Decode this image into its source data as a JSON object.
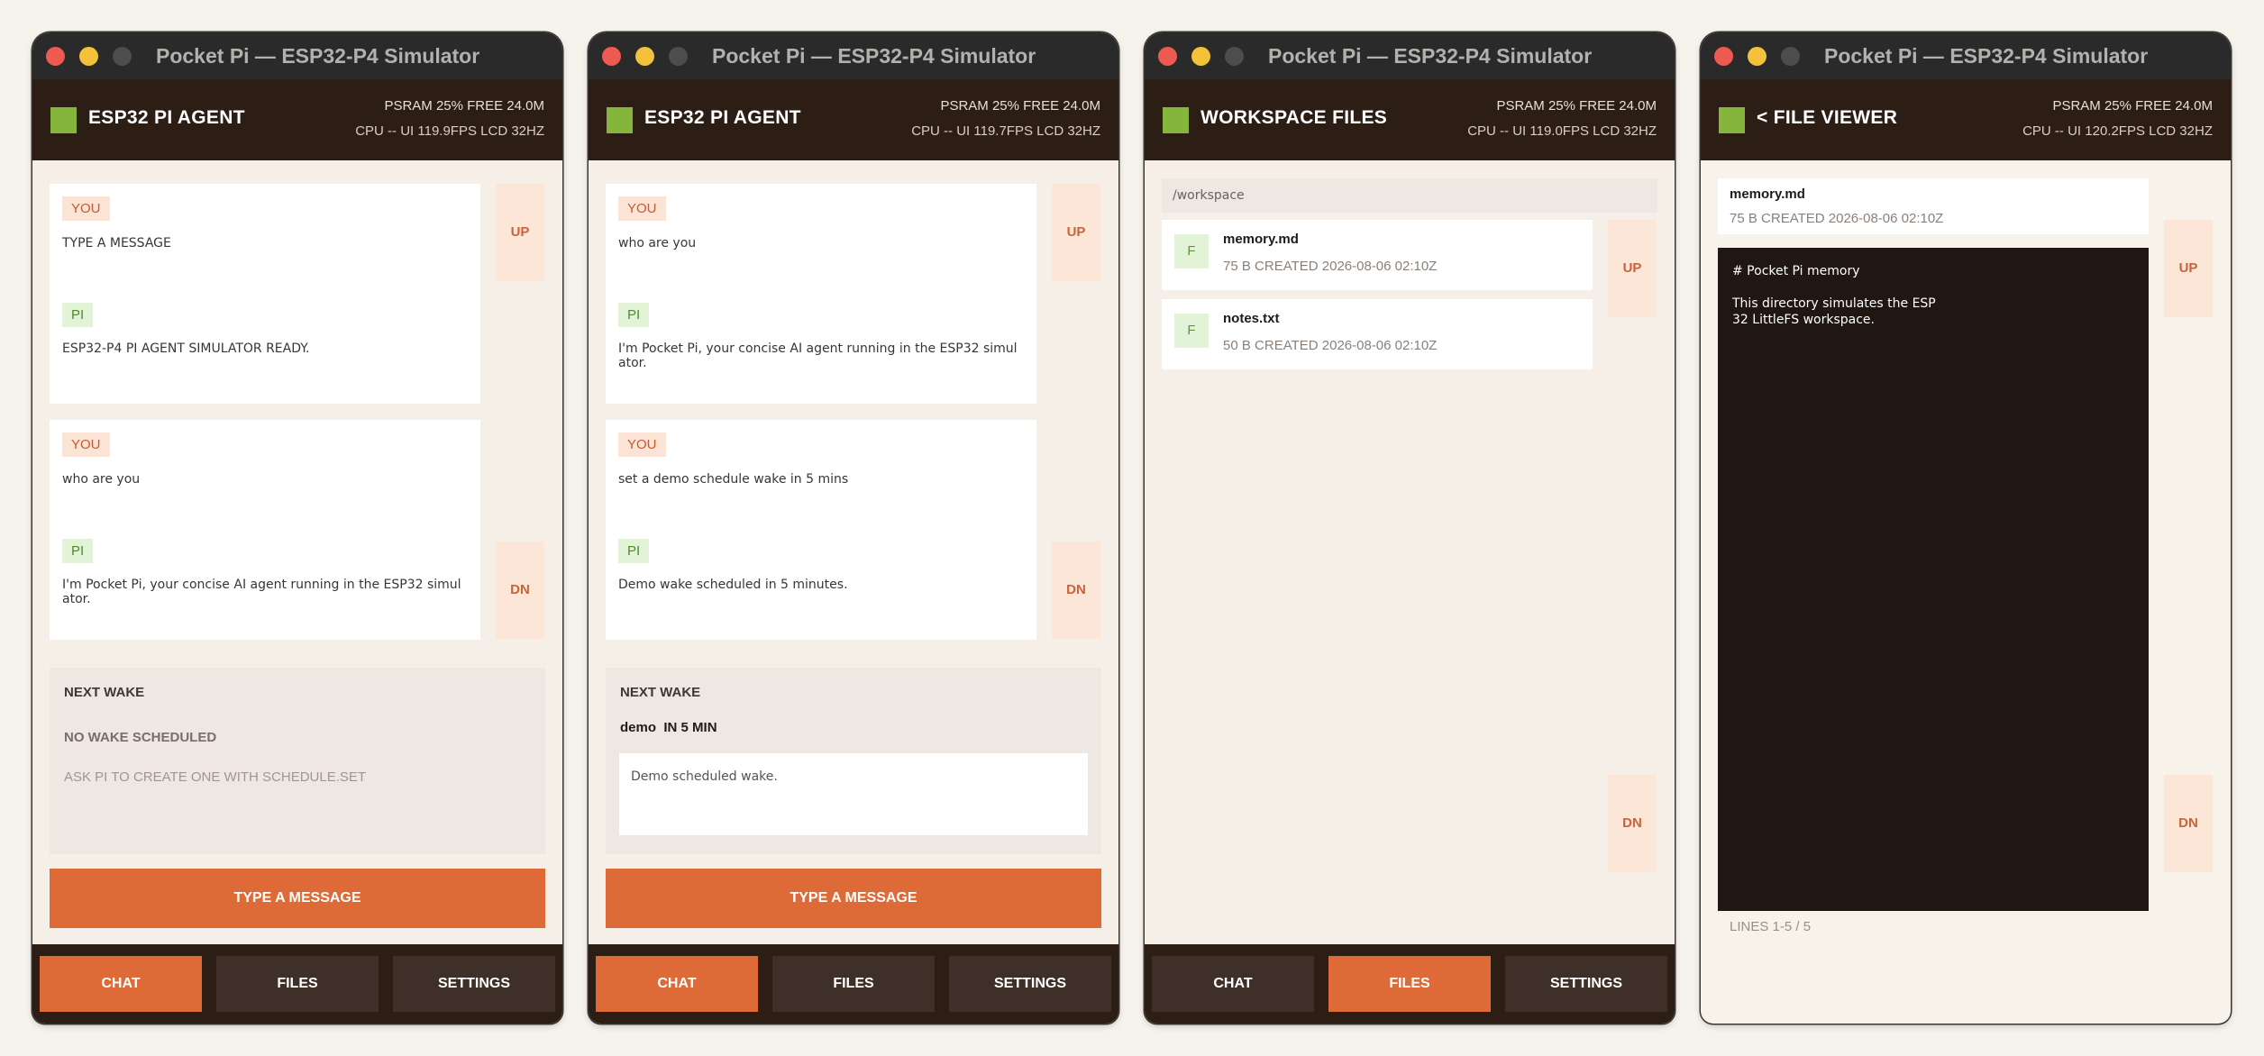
{
  "window_title": "Pocket Pi — ESP32-P4 Simulator",
  "colors": {
    "accent": "#de6a38",
    "header_bg": "#2c1d15",
    "status_square": "#86b53c",
    "you_tag_bg": "#fbe4d6",
    "pi_tag_bg": "#e3f3d8"
  },
  "tag_you": "YOU",
  "tag_pi": "PI",
  "nav_up": "UP",
  "nav_down": "DN",
  "send_label": "TYPE A MESSAGE",
  "tabs": [
    "CHAT",
    "FILES",
    "SETTINGS"
  ],
  "windows": [
    {
      "title": "ESP32 PI AGENT",
      "stats": {
        "line1": "PSRAM 25%  FREE 24.0M",
        "line2": "CPU --  UI 119.9FPS  LCD 32HZ"
      },
      "active_tab": "CHAT",
      "messages": [
        {
          "you": "TYPE A MESSAGE",
          "pi": "ESP32-P4 PI AGENT SIMULATOR READY."
        },
        {
          "you": "who are you",
          "pi": "I'm Pocket Pi, your concise AI agent running in the ESP32 simul\nator."
        }
      ],
      "wake": {
        "heading": "NEXT WAKE",
        "status": "NO WAKE SCHEDULED",
        "hint": "ASK PI TO CREATE ONE WITH SCHEDULE.SET"
      }
    },
    {
      "title": "ESP32 PI AGENT",
      "stats": {
        "line1": "PSRAM 25%  FREE 24.0M",
        "line2": "CPU --  UI 119.7FPS  LCD 32HZ"
      },
      "active_tab": "CHAT",
      "messages": [
        {
          "you": "who are you",
          "pi": "I'm Pocket Pi, your concise AI agent running in the ESP32 simul\nator."
        },
        {
          "you": "set a demo schedule wake in 5 mins",
          "pi": "Demo wake scheduled in 5 minutes."
        }
      ],
      "wake": {
        "heading": "NEXT WAKE",
        "name": "demo",
        "when": "IN 5 MIN",
        "note": "Demo scheduled wake."
      }
    },
    {
      "title": "WORKSPACE FILES",
      "stats": {
        "line1": "PSRAM 25%  FREE 24.0M",
        "line2": "CPU --  UI 119.0FPS  LCD 32HZ"
      },
      "active_tab": "FILES",
      "path": "/workspace",
      "file_icon_letter": "F",
      "files": [
        {
          "name": "memory.md",
          "meta": "75 B  CREATED 2026-08-06 02:10Z"
        },
        {
          "name": "notes.txt",
          "meta": "50 B  CREATED 2026-08-06 02:10Z"
        }
      ]
    },
    {
      "title": "< FILE VIEWER",
      "stats": {
        "line1": "PSRAM 25%  FREE 24.0M",
        "line2": "CPU --  UI 120.2FPS  LCD 32HZ"
      },
      "file": {
        "name": "memory.md",
        "meta": "75 B  CREATED 2026-08-06 02:10Z",
        "content": "# Pocket Pi memory\n\nThis directory simulates the ESP\n32 LittleFS workspace.",
        "lines_label": "LINES 1-5 / 5"
      }
    }
  ]
}
